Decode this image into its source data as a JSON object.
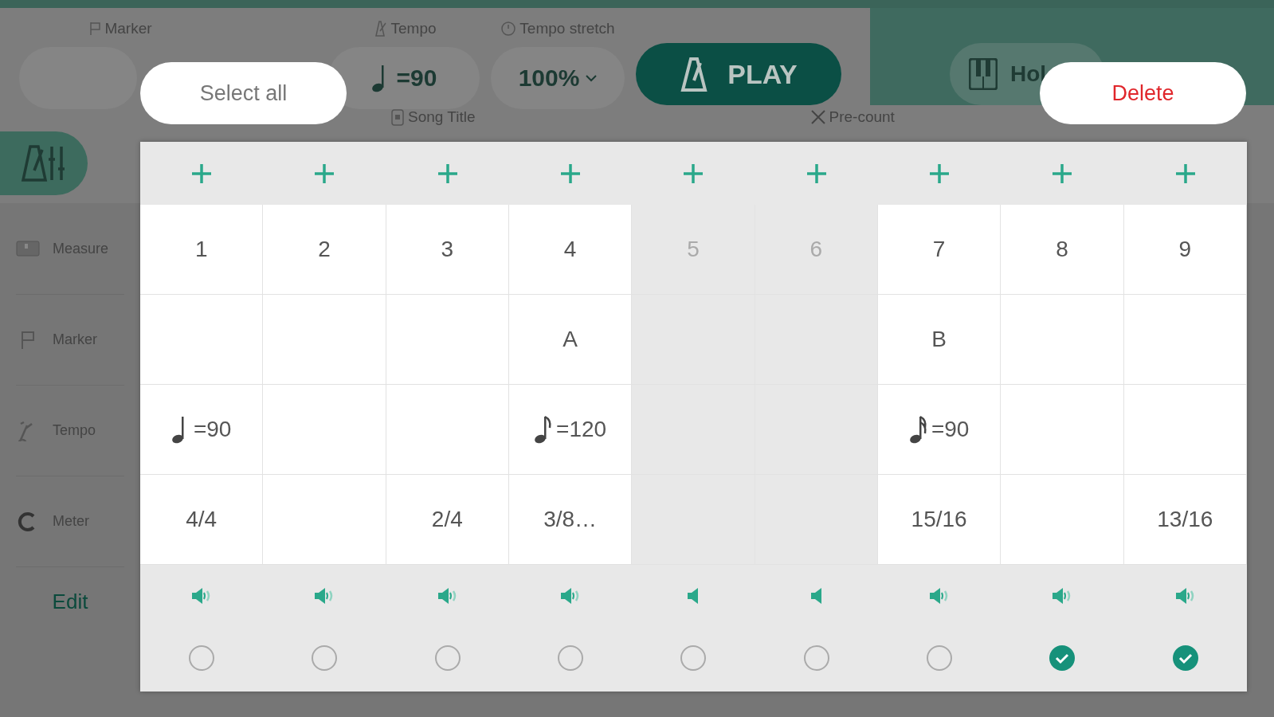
{
  "background": {
    "marker_label": "Marker",
    "tempo_label": "Tempo",
    "tempo_value": "=90",
    "tempo_stretch_label": "Tempo stretch",
    "tempo_stretch_value": "100%",
    "play_button": "PLAY",
    "hold_button": "Hol",
    "song_title_label": "Song Title",
    "precount_label": "Pre-count",
    "sidebar": [
      {
        "label": "Measure",
        "kind": "measure"
      },
      {
        "label": "Marker",
        "kind": "marker"
      },
      {
        "label": "Tempo",
        "kind": "tempo"
      },
      {
        "label": "Meter",
        "kind": "meter"
      }
    ],
    "edit_link": "Edit"
  },
  "toolbar": {
    "select_all": "Select all",
    "delete": "Delete"
  },
  "measures": [
    {
      "number": "1",
      "tempo": {
        "kind": "quarter",
        "value": "=90"
      },
      "meter": "4/4",
      "muted": false,
      "selected": false
    },
    {
      "number": "2",
      "muted": false,
      "selected": false
    },
    {
      "number": "3",
      "meter": "2/4",
      "muted": false,
      "selected": false
    },
    {
      "number": "4",
      "marker": "A",
      "tempo": {
        "kind": "eighth",
        "value": "=120"
      },
      "meter": "3/8…",
      "muted": false,
      "selected": false
    },
    {
      "number": "5",
      "muted": true,
      "selected": false
    },
    {
      "number": "6",
      "muted": true,
      "selected": false
    },
    {
      "number": "7",
      "marker": "B",
      "tempo": {
        "kind": "sixteenth",
        "value": "=90"
      },
      "meter": "15/16",
      "muted": false,
      "selected": false
    },
    {
      "number": "8",
      "muted": false,
      "selected": true
    },
    {
      "number": "9",
      "meter": "13/16",
      "muted": false,
      "selected": true
    }
  ]
}
